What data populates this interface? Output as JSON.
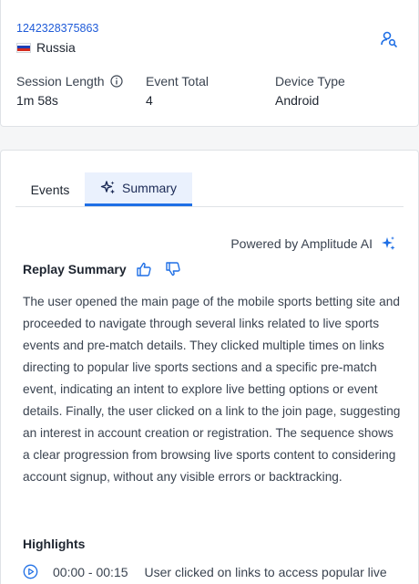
{
  "user": {
    "id": "1242328375863",
    "country": "Russia",
    "search_icon": "user-search-icon"
  },
  "stats": [
    {
      "label": "Session Length",
      "value": "1m 58s",
      "info_icon": true
    },
    {
      "label": "Event Total",
      "value": "4"
    },
    {
      "label": "Device Type",
      "value": "Android"
    }
  ],
  "tabs": [
    {
      "label": "Events",
      "active": false
    },
    {
      "label": "Summary",
      "active": true,
      "icon": "sparkle-icon"
    }
  ],
  "powered_by": "Powered by Amplitude AI",
  "replay_summary": {
    "title": "Replay Summary",
    "text": "The user opened the main page of the mobile sports betting site and proceeded to navigate through several links related to live sports events and pre-match details. They clicked multiple times on links directing to popular live sports sections and a specific pre-match event, indicating an intent to explore live betting options or event details. Finally, the user clicked on a link to the join page, suggesting an interest in account creation or registration. The sequence shows a clear progression from browsing live sports content to considering account signup, without any visible errors or backtracking."
  },
  "highlights": {
    "title": "Highlights",
    "items": [
      {
        "time": "00:00 - 00:15",
        "text": "User clicked on links to access popular live"
      }
    ]
  },
  "colors": {
    "accent": "#1f6fe5",
    "link": "#1f5bd8",
    "active_tab_bg": "#eaf1fd"
  }
}
